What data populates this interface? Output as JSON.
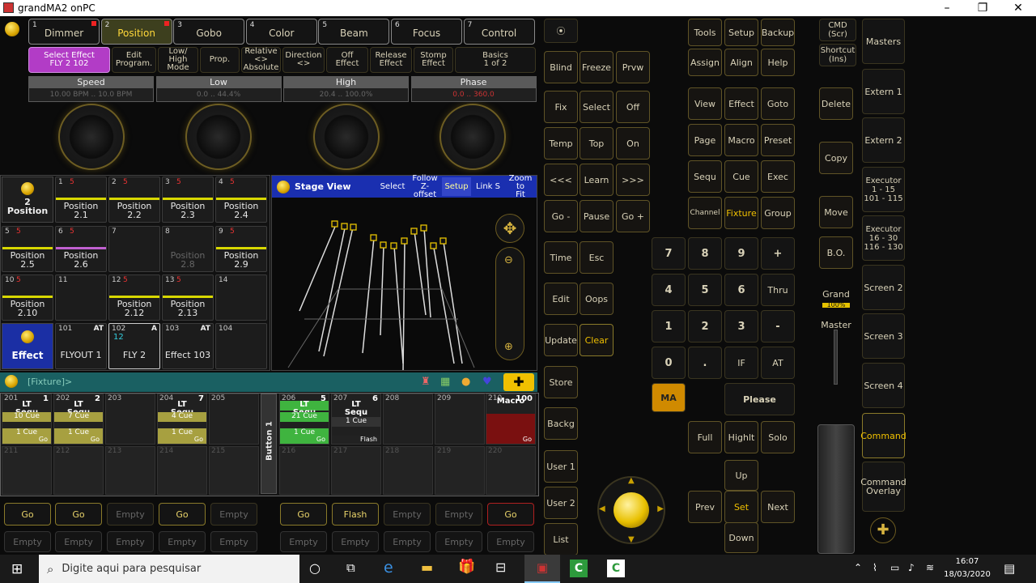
{
  "window": {
    "title": "grandMA2 onPC"
  },
  "presettypes": [
    {
      "num": "1",
      "label": "Dimmer"
    },
    {
      "num": "2",
      "label": "Position"
    },
    {
      "num": "3",
      "label": "Gobo"
    },
    {
      "num": "4",
      "label": "Color"
    },
    {
      "num": "5",
      "label": "Beam"
    },
    {
      "num": "6",
      "label": "Focus"
    },
    {
      "num": "7",
      "label": "Control"
    }
  ],
  "features": [
    {
      "label": "Select Effect\nFLY 2 102"
    },
    {
      "label": "Edit\nProgram."
    },
    {
      "label": "Low/\nHigh\nMode"
    },
    {
      "label": "Prop."
    },
    {
      "label": "Relative\n<>\nAbsolute"
    },
    {
      "label": "Direction\n<>"
    },
    {
      "label": "Off\nEffect"
    },
    {
      "label": "Release\nEffect"
    },
    {
      "label": "Stomp\nEffect"
    },
    {
      "label": "Basics\n1 of 2"
    }
  ],
  "encoders": [
    {
      "title": "Speed",
      "value": "10.00 BPM .. 10.0 BPM"
    },
    {
      "title": "Low",
      "value": "0.0 .. 44.4%"
    },
    {
      "title": "High",
      "value": "20.4 .. 100.0%"
    },
    {
      "title": "Phase",
      "value": "0.0 .. 360.0"
    }
  ],
  "pool": {
    "position_label": "2\nPosition",
    "effect_label": "Effect",
    "items": [
      {
        "num": "1",
        "red": "5",
        "label": "Position 2.1"
      },
      {
        "num": "2",
        "red": "5",
        "label": "Position 2.2"
      },
      {
        "num": "3",
        "red": "5",
        "label": "Position 2.3"
      },
      {
        "num": "4",
        "red": "5",
        "label": "Position 2.4"
      },
      {
        "num": "5",
        "red": "5",
        "label": "Position 2.5"
      },
      {
        "num": "6",
        "red": "5",
        "label": "Position 2.6"
      },
      {
        "num": "7",
        "red": "",
        "label": ""
      },
      {
        "num": "8",
        "red": "",
        "label": "Position 2.8"
      },
      {
        "num": "9",
        "red": "5",
        "label": "Position 2.9"
      },
      {
        "num": "10",
        "red": "5",
        "label": "Position\n2.10"
      },
      {
        "num": "11",
        "red": "",
        "label": ""
      },
      {
        "num": "12",
        "red": "5",
        "label": "Position\n2.12"
      },
      {
        "num": "13",
        "red": "5",
        "label": "Position\n2.13"
      },
      {
        "num": "14",
        "red": "",
        "label": ""
      }
    ],
    "effects": [
      {
        "num": "101",
        "tag": "AT",
        "label": "FLYOUT 1"
      },
      {
        "num": "102",
        "tag": "A",
        "sub": "12",
        "label": "FLY 2"
      },
      {
        "num": "103",
        "tag": "AT",
        "label": "Effect 103"
      },
      {
        "num": "104",
        "tag": "",
        "label": ""
      }
    ]
  },
  "stage": {
    "title": "Stage View",
    "buttons": [
      "Select",
      "Follow\nZ-offset",
      "Setup",
      "Link S",
      "Zoom to\nFit"
    ]
  },
  "cmdline": {
    "text": "[Fixture]>"
  },
  "executors": [
    {
      "num": "201",
      "tag": "1",
      "type": "LT\nSequ",
      "cue": "10 Cue",
      "cur": "1 Cue",
      "foot": "Go",
      "style": "yellow"
    },
    {
      "num": "202",
      "tag": "2",
      "type": "LT\nSequ",
      "cue": "7 Cue",
      "cur": "1 Cue",
      "foot": "Go",
      "style": "yellow"
    },
    {
      "num": "203",
      "tag": "",
      "type": "",
      "cue": "",
      "cur": "",
      "foot": "",
      "style": "empty"
    },
    {
      "num": "204",
      "tag": "7",
      "type": "LT\nSequ",
      "cue": "4 Cue",
      "cur": "1 Cue",
      "foot": "Go",
      "style": "yellow"
    },
    {
      "num": "205",
      "tag": "",
      "type": "",
      "cue": "",
      "cur": "",
      "foot": "",
      "style": "empty"
    },
    {
      "num": "206",
      "tag": "5",
      "type": "LT\nSequ",
      "cue": "21 Cue",
      "cur": "1 Cue",
      "foot": "Go",
      "style": "green"
    },
    {
      "num": "207",
      "tag": "6",
      "type": "LT\nSequ",
      "cue": "",
      "cur": "1 Cue",
      "foot": "Flash",
      "style": "plain"
    },
    {
      "num": "208",
      "tag": "",
      "type": "",
      "cue": "",
      "cur": "",
      "foot": "",
      "style": "empty"
    },
    {
      "num": "209",
      "tag": "",
      "type": "",
      "cue": "",
      "cur": "",
      "foot": "",
      "style": "empty"
    },
    {
      "num": "210",
      "tag": "100",
      "type": "Macro",
      "cue": "",
      "cur": "",
      "foot": "Go",
      "style": "red"
    }
  ],
  "exec_row2": [
    "211",
    "212",
    "213",
    "214",
    "215",
    "216",
    "217",
    "218",
    "219",
    "220"
  ],
  "exec_button_label": "Button 1",
  "exec_buttons_top": [
    "Go",
    "Go",
    "Empty",
    "Go",
    "Empty",
    "Go",
    "Flash",
    "Empty",
    "Empty",
    "Go"
  ],
  "exec_buttons_bottom": [
    "Empty",
    "Empty",
    "Empty",
    "Empty",
    "Empty",
    "Empty",
    "Empty",
    "Empty",
    "Empty",
    "Empty"
  ],
  "keys": {
    "col1": [
      "Blind",
      "Fix",
      "Temp",
      "<<<",
      "Go -",
      "Time",
      "Edit",
      "Update",
      "Store",
      "Backg",
      "User 1",
      "User 2",
      "List"
    ],
    "col2": [
      "Freeze",
      "Select",
      "Top",
      "Learn",
      "Pause",
      "Esc",
      "Oops",
      "Clear"
    ],
    "col3": [
      "Prvw",
      "Off",
      "On",
      ">>>",
      "Go +"
    ],
    "top3": [
      "Tools",
      "Setup",
      "Backup",
      "Assign",
      "Align",
      "Help"
    ],
    "grid": [
      "View",
      "Effect",
      "Goto",
      "Page",
      "Macro",
      "Preset",
      "Sequ",
      "Cue",
      "Exec",
      "Channel",
      "Fixture",
      "Group"
    ],
    "numpad": [
      "7",
      "8",
      "9",
      "+",
      "4",
      "5",
      "6",
      "Thru",
      "1",
      "2",
      "3",
      "-",
      "0",
      ".",
      "IF",
      "AT"
    ],
    "ma": "MA",
    "please": "Please",
    "fhs": [
      "Full",
      "Highlt",
      "Solo"
    ],
    "nav": {
      "up": "Up",
      "prev": "Prev",
      "set": "Set",
      "next": "Next",
      "down": "Down"
    },
    "cmd": "CMD\n(Scr)",
    "shortcut": "Shortcut\n(Ins)",
    "right": [
      "Delete",
      "Copy",
      "Move",
      "B.O."
    ],
    "grand": "Grand",
    "grand_pct": "100%",
    "master": "Master"
  },
  "sidebar": [
    "Masters",
    "Extern 1",
    "Extern 2",
    "Executor\n1 - 15\n101 - 115",
    "Executor\n16 - 30\n116 - 130",
    "Screen 2",
    "Screen 3",
    "Screen 4",
    "Command",
    "Command\nOverlay"
  ],
  "taskbar": {
    "search": "Digite aqui para pesquisar",
    "time": "16:07",
    "date": "18/03/2020"
  }
}
